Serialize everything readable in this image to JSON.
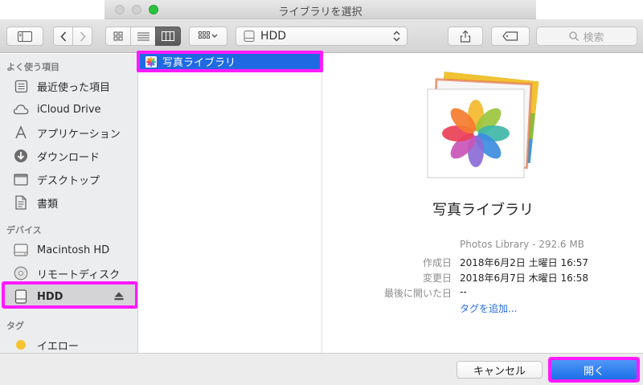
{
  "window": {
    "title": "ライブラリを選択"
  },
  "toolbar": {
    "path_label": "HDD",
    "search_placeholder": "検索"
  },
  "sidebar": {
    "sections": [
      {
        "header": "よく使う項目"
      },
      {
        "header": "デバイス"
      },
      {
        "header": "タグ"
      }
    ],
    "favorites": [
      {
        "label": "最近使った項目",
        "icon": "recents-icon"
      },
      {
        "label": "iCloud Drive",
        "icon": "cloud-icon"
      },
      {
        "label": "アプリケーション",
        "icon": "applications-icon"
      },
      {
        "label": "ダウンロード",
        "icon": "downloads-icon"
      },
      {
        "label": "デスクトップ",
        "icon": "desktop-icon"
      },
      {
        "label": "書類",
        "icon": "documents-icon"
      }
    ],
    "devices": [
      {
        "label": "Macintosh HD",
        "icon": "hard-drive-icon"
      },
      {
        "label": "リモートディスク",
        "icon": "remote-disc-icon"
      },
      {
        "label": "HDD",
        "icon": "external-drive-icon",
        "selected": true
      }
    ],
    "tags": [
      {
        "label": "イエロー",
        "color": "#f6c433"
      }
    ]
  },
  "column1": {
    "items": [
      {
        "label": "写真ライブラリ",
        "icon": "photos-library-icon",
        "selected": true
      }
    ]
  },
  "preview": {
    "title": "写真ライブラリ",
    "kind": "Photos Library - 292.6 MB",
    "rows": [
      {
        "key": "作成日",
        "value": "2018年6月2日 土曜日 16:57"
      },
      {
        "key": "変更日",
        "value": "2018年6月7日 木曜日 16:58"
      },
      {
        "key": "最後に開いた日",
        "value": "--"
      }
    ],
    "add_tags_link": "タグを追加..."
  },
  "buttons": {
    "cancel": "キャンセル",
    "open": "開く"
  },
  "colors": {
    "selection": "#1f6ae3",
    "highlight": "#ff1aff",
    "link": "#2a6fe0"
  }
}
